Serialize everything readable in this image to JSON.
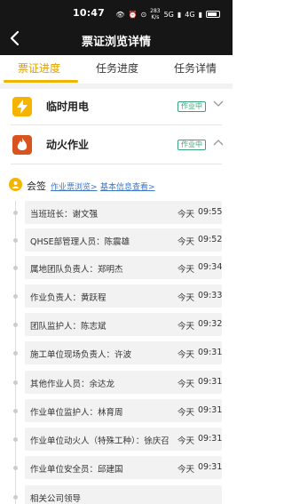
{
  "status_bar": {
    "time": "10:47",
    "net_speed_value": "283",
    "net_speed_unit": "K/s",
    "signal": "5G",
    "network": "4G",
    "battery_level": 0.8
  },
  "nav": {
    "back_icon": "chevron-left-icon",
    "title": "票证浏览详情"
  },
  "tabs": [
    {
      "label": "票证进度",
      "active": true
    },
    {
      "label": "任务进度",
      "active": false
    },
    {
      "label": "任务详情",
      "active": false
    }
  ],
  "categories": [
    {
      "name": "临时用电",
      "status": "作业中",
      "icon": "lightning-icon",
      "icon_color": "#f5b400",
      "expanded": false
    },
    {
      "name": "动火作业",
      "status": "作业中",
      "icon": "flame-icon",
      "icon_color": "#d9531e",
      "expanded": true
    }
  ],
  "sign": {
    "label": "会签",
    "links": [
      "作业票浏览>",
      "基本信息查看>"
    ]
  },
  "records": [
    {
      "label": "当班班长：谢文强",
      "day": "今天",
      "time": "09:55"
    },
    {
      "label": "QHSE部管理人员：陈震雄",
      "day": "今天",
      "time": "09:52"
    },
    {
      "label": "属地团队负责人：郑明杰",
      "day": "今天",
      "time": "09:34"
    },
    {
      "label": "作业负责人：黄跃程",
      "day": "今天",
      "time": "09:33"
    },
    {
      "label": "团队监护人：陈志斌",
      "day": "今天",
      "time": "09:32"
    },
    {
      "label": "施工单位现场负责人：许波",
      "day": "今天",
      "time": "09:31"
    },
    {
      "label": "其他作业人员：余达龙",
      "day": "今天",
      "time": "09:31"
    },
    {
      "label": "作业单位监护人：林育周",
      "day": "今天",
      "time": "09:31"
    },
    {
      "label": "作业单位动火人（特殊工种）：徐庆召",
      "day": "今天",
      "time": "09:31"
    },
    {
      "label": "作业单位安全员：邱建国",
      "day": "今天",
      "time": "09:31"
    },
    {
      "label": "相关公司领导",
      "day": "",
      "time": ""
    }
  ],
  "colors": {
    "accent": "#f0b400",
    "status_green": "#3aa37b",
    "link_blue": "#3c78c8"
  }
}
